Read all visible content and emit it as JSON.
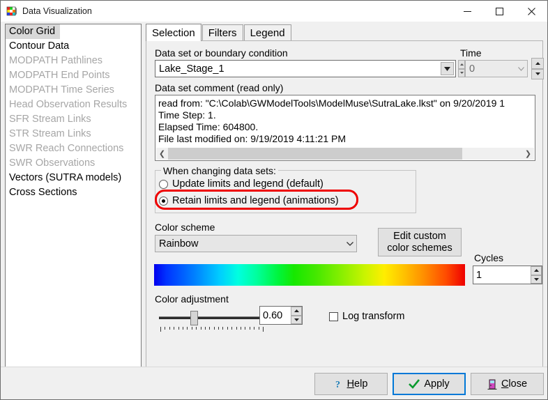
{
  "window": {
    "title": "Data Visualization",
    "icon": "color-grid-icon",
    "minimize": "minimize-icon",
    "maximize": "maximize-icon",
    "close": "close-icon"
  },
  "sidebar": {
    "items": [
      {
        "label": "Color Grid",
        "enabled": true,
        "selected": true
      },
      {
        "label": "Contour Data",
        "enabled": true,
        "selected": false
      },
      {
        "label": "MODPATH Pathlines",
        "enabled": false,
        "selected": false
      },
      {
        "label": "MODPATH End Points",
        "enabled": false,
        "selected": false
      },
      {
        "label": "MODPATH Time Series",
        "enabled": false,
        "selected": false
      },
      {
        "label": "Head Observation Results",
        "enabled": false,
        "selected": false
      },
      {
        "label": "SFR Stream Links",
        "enabled": false,
        "selected": false
      },
      {
        "label": "STR Stream Links",
        "enabled": false,
        "selected": false
      },
      {
        "label": "SWR Reach Connections",
        "enabled": false,
        "selected": false
      },
      {
        "label": "SWR Observations",
        "enabled": false,
        "selected": false
      },
      {
        "label": "Vectors (SUTRA models)",
        "enabled": true,
        "selected": false
      },
      {
        "label": "Cross Sections",
        "enabled": true,
        "selected": false
      }
    ]
  },
  "tabs": [
    {
      "label": "Selection",
      "active": true
    },
    {
      "label": "Filters",
      "active": false
    },
    {
      "label": "Legend",
      "active": false
    }
  ],
  "selection": {
    "dataset_label": "Data set or boundary condition",
    "dataset_value": "Lake_Stage_1",
    "time_label": "Time",
    "time_value": "0",
    "comment_label": "Data set comment (read only)",
    "comment_lines": [
      "read from: \"C:\\Colab\\GWModelTools\\ModelMuse\\SutraLake.lkst\" on 9/20/2019 1",
      "Time Step: 1.",
      "Elapsed Time: 604800.",
      "File last modified on: 9/19/2019 4:11:21 PM"
    ],
    "changing_group_title": "When changing data sets:",
    "radio_update": "Update limits and legend (default)",
    "radio_retain": "Retain limits and legend (animations)",
    "radio_selected": "retain",
    "color_scheme_label": "Color scheme",
    "color_scheme_value": "Rainbow",
    "edit_custom_line1": "Edit custom",
    "edit_custom_line2": "color schemes",
    "cycles_label": "Cycles",
    "cycles_value": "1",
    "color_adjustment_label": "Color adjustment",
    "color_adjustment_value": "0.60",
    "log_transform_label": "Log transform",
    "log_transform_checked": false,
    "highlight_color": "#ee0000"
  },
  "footer": {
    "help": "Help",
    "apply": "Apply",
    "close": "Close",
    "help_icon": "question-mark-icon",
    "apply_icon": "checkmark-icon",
    "close_icon": "door-exit-icon"
  }
}
